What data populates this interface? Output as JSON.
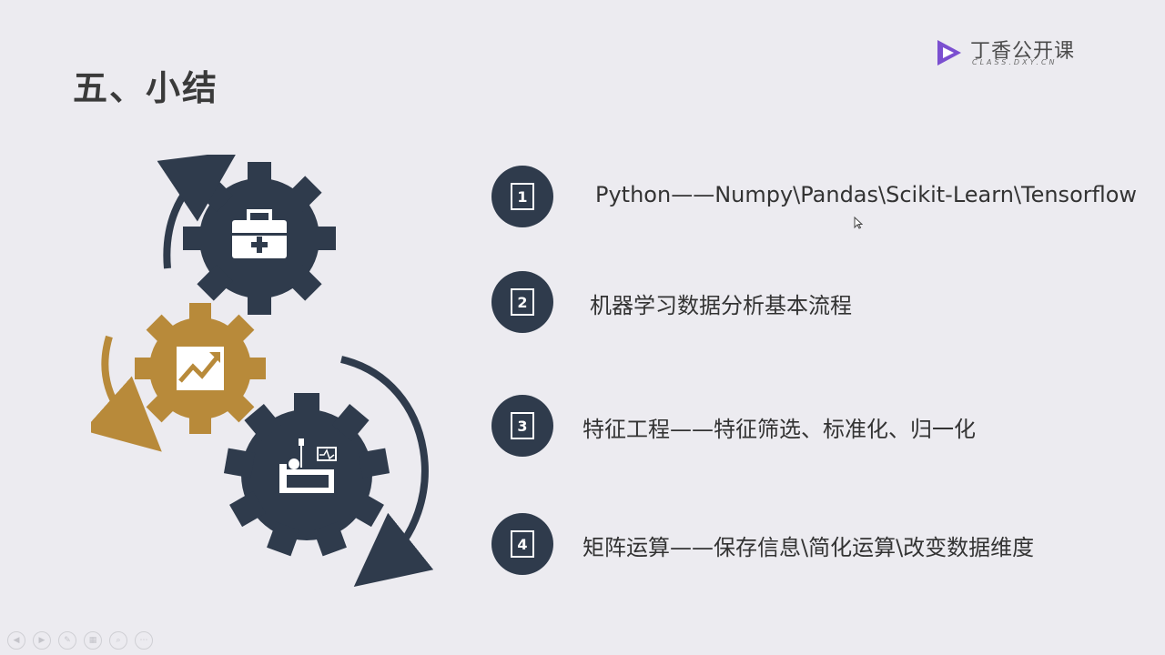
{
  "slide": {
    "title": "五、小结"
  },
  "logo": {
    "name": "丁香公开课",
    "subtitle": "CLASS.DXY.CN"
  },
  "items": [
    {
      "number": "1",
      "text": "Python——Numpy\\Pandas\\Scikit-Learn\\Tensorflow"
    },
    {
      "number": "2",
      "text": "机器学习数据分析基本流程"
    },
    {
      "number": "3",
      "text": "特征工程——特征筛选、标准化、归一化"
    },
    {
      "number": "4",
      "text": "矩阵运算——保存信息\\简化运算\\改变数据维度"
    }
  ],
  "colors": {
    "gear_dark": "#2f3b4c",
    "gear_gold": "#b88a3a",
    "background": "#ecebf0",
    "logo_purple": "#7b4fd0"
  },
  "icons": {
    "gear1": "medical-kit-icon",
    "gear2": "growth-chart-icon",
    "gear3": "hospital-bed-icon"
  }
}
